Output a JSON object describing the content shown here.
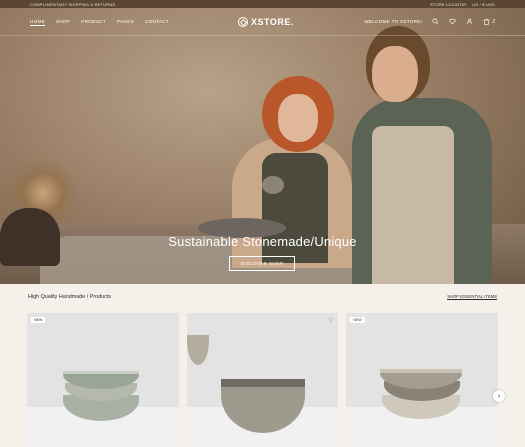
{
  "topbar": {
    "left": "COMPLIMENTARY SHIPPING & RETURNS",
    "store_locator": "STORE LOCATOR",
    "locale": "US / $ USD"
  },
  "nav": {
    "links": [
      "HOME",
      "SHOP",
      "PRODUCT",
      "PAGES",
      "CONTACT"
    ],
    "logo": "XSTORE.",
    "welcome": "WELCOME TO XSTORE!",
    "cart_count": "2"
  },
  "hero": {
    "title": "Sustainable Stonemade/Unique",
    "button": "DISCOVER SHOP"
  },
  "section": {
    "title": "High Quality Handmade / Products",
    "link": "SHOP ESSENTIAL ITEMS"
  },
  "products": [
    {
      "badge": "NEW"
    },
    {
      "badge": ""
    },
    {
      "badge": "NEW"
    }
  ],
  "icons": [
    "search-icon",
    "heart-icon",
    "user-icon",
    "cart-icon",
    "chevron-right-icon"
  ]
}
